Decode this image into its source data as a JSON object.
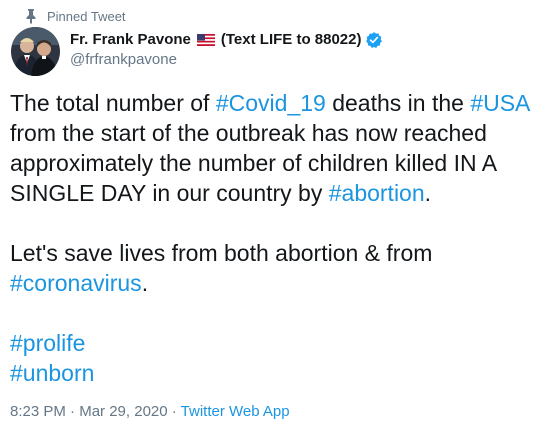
{
  "pinned": {
    "label": "Pinned Tweet",
    "icon": "pin-icon"
  },
  "author": {
    "display_name": "Fr. Frank Pavone",
    "flag_icon": "us-flag-icon",
    "name_suffix": "(Text LIFE to 88022)",
    "verified_icon": "verified-badge-icon",
    "handle": "@frfrankpavone"
  },
  "tweet": {
    "p1": {
      "t1": "The total number of ",
      "tag1": "#Covid_19",
      "t2": " deaths in the ",
      "tag2": "#USA",
      "t3": " from the start of the outbreak has now reached approximately the number of children killed IN A SINGLE DAY in our country by ",
      "tag3": "#abortion",
      "t4": "."
    },
    "p2": {
      "t1": "Let's save lives from both abortion & from ",
      "tag1": "#coronavirus",
      "t2": "."
    },
    "hashtags": [
      "#prolife",
      "#unborn"
    ]
  },
  "meta": {
    "time": "8:23 PM",
    "sep1": " · ",
    "date": "Mar 29, 2020",
    "sep2": " · ",
    "app": "Twitter Web App"
  },
  "colors": {
    "link": "#1b95e0",
    "text": "#14171a",
    "secondary": "#657786"
  }
}
